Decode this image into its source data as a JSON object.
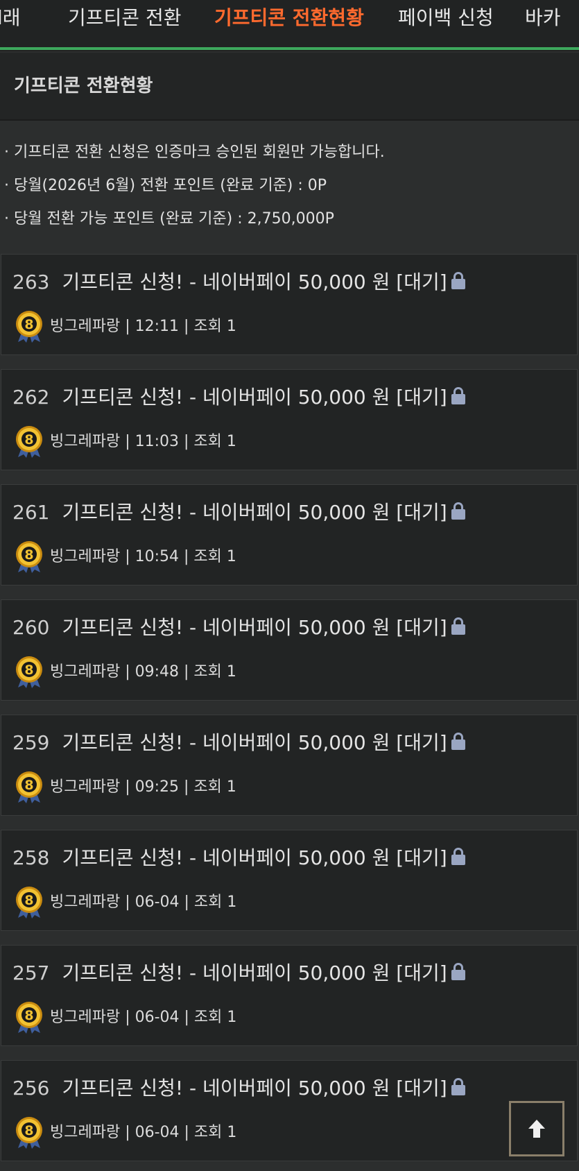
{
  "tabs": [
    {
      "label": "l래",
      "active": false
    },
    {
      "label": "기프티콘 전환",
      "active": false
    },
    {
      "label": "기프티콘 전환현황",
      "active": true
    },
    {
      "label": "페이백 신청",
      "active": false
    },
    {
      "label": "바카",
      "active": false
    }
  ],
  "header": {
    "title": "기프티콘 전환현황"
  },
  "notices": [
    "· 기프티콘 전환 신청은 인증마크 승인된 회원만 가능합니다.",
    "·  당월(2026년 6월) 전환 포인트 (완료 기준) : 0P",
    "·  당월 전환 가능 포인트 (완료 기준) : 2,750,000P"
  ],
  "posts": [
    {
      "number": "263",
      "title": "기프티콘 신청! - 네이버페이 50,000 원 [대기]",
      "level": "8",
      "meta": "빙그레파랑 | 12:11 | 조회 1"
    },
    {
      "number": "262",
      "title": "기프티콘 신청! - 네이버페이 50,000 원 [대기]",
      "level": "8",
      "meta": "빙그레파랑 | 11:03 | 조회 1"
    },
    {
      "number": "261",
      "title": "기프티콘 신청! - 네이버페이 50,000 원 [대기]",
      "level": "8",
      "meta": "빙그레파랑 | 10:54 | 조회 1"
    },
    {
      "number": "260",
      "title": "기프티콘 신청! - 네이버페이 50,000 원 [대기]",
      "level": "8",
      "meta": "빙그레파랑 | 09:48 | 조회 1"
    },
    {
      "number": "259",
      "title": "기프티콘 신청! - 네이버페이 50,000 원 [대기]",
      "level": "8",
      "meta": "빙그레파랑 | 09:25 | 조회 1"
    },
    {
      "number": "258",
      "title": "기프티콘 신청! - 네이버페이 50,000 원 [대기]",
      "level": "8",
      "meta": "빙그레파랑 | 06-04 | 조회 1"
    },
    {
      "number": "257",
      "title": "기프티콘 신청! - 네이버페이 50,000 원 [대기]",
      "level": "8",
      "meta": "빙그레파랑 | 06-04 | 조회 1"
    },
    {
      "number": "256",
      "title": "기프티콘 신청! - 네이버페이 50,000 원 [대기]",
      "level": "8",
      "meta": "빙그레파랑 | 06-04 | 조회 1"
    }
  ],
  "icons": {
    "lock": "lock-icon",
    "level_badge": "level-badge-icon",
    "scroll_top": "arrow-up-icon"
  },
  "colors": {
    "active_tab": "#ff6a2e",
    "accent_line": "#3da85c",
    "lock": "#9aa6c2",
    "badge_gold": "#e8b21e"
  }
}
